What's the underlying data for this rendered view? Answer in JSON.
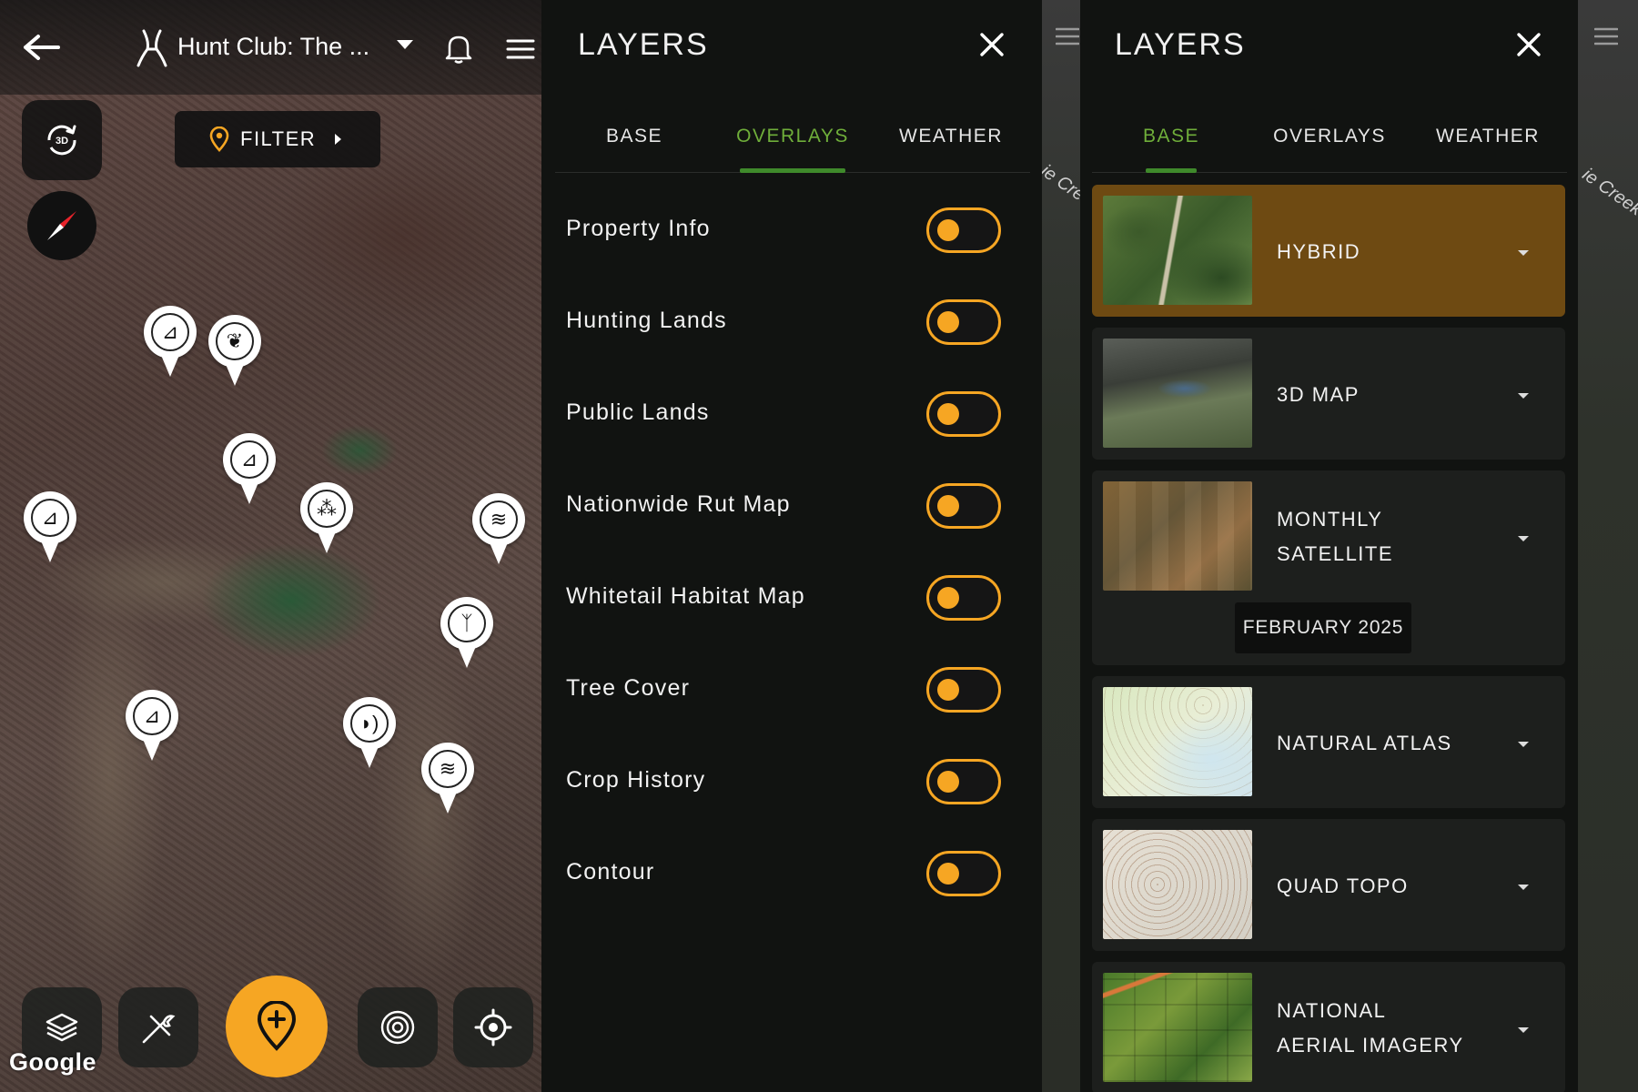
{
  "map_screen": {
    "title": "Hunt Club: The ...",
    "filter_label": "FILTER",
    "three_d_label": "3D",
    "attribution": "Google",
    "pins": [
      {
        "icon": "stand-icon"
      },
      {
        "icon": "track-icon"
      },
      {
        "icon": "stand-icon"
      },
      {
        "icon": "feeder-icon"
      },
      {
        "icon": "stand-icon"
      },
      {
        "icon": "water-icon"
      },
      {
        "icon": "bedding-icon"
      },
      {
        "icon": "stand-icon"
      },
      {
        "icon": "sound-icon"
      },
      {
        "icon": "water-icon"
      }
    ],
    "bottom_icons": [
      "layers-icon",
      "tools-icon",
      "add-marker-icon",
      "scan-icon",
      "locate-icon"
    ]
  },
  "overlays_panel": {
    "title": "LAYERS",
    "tabs": [
      {
        "label": "BASE",
        "active": false
      },
      {
        "label": "OVERLAYS",
        "active": true
      },
      {
        "label": "WEATHER",
        "active": false
      }
    ],
    "items": [
      {
        "label": "Property Info",
        "on": false
      },
      {
        "label": "Hunting Lands",
        "on": false
      },
      {
        "label": "Public Lands",
        "on": false
      },
      {
        "label": "Nationwide Rut Map",
        "on": false
      },
      {
        "label": "Whitetail Habitat Map",
        "on": false
      },
      {
        "label": "Tree Cover",
        "on": false
      },
      {
        "label": "Crop History",
        "on": false
      },
      {
        "label": "Contour",
        "on": false
      }
    ]
  },
  "base_panel": {
    "title": "LAYERS",
    "tabs": [
      {
        "label": "BASE",
        "active": true
      },
      {
        "label": "OVERLAYS",
        "active": false
      },
      {
        "label": "WEATHER",
        "active": false
      }
    ],
    "items": [
      {
        "label": "HYBRID",
        "selected": true
      },
      {
        "label": "3D MAP",
        "selected": false
      },
      {
        "label_line1": "MONTHLY",
        "label_line2": "SATELLITE",
        "date": "FEBRUARY 2025",
        "selected": false
      },
      {
        "label": "NATURAL ATLAS",
        "selected": false
      },
      {
        "label": "QUAD TOPO",
        "selected": false
      },
      {
        "label_line1": "NATIONAL",
        "label_line2": "AERIAL IMAGERY",
        "selected": false
      }
    ]
  },
  "background_map_labels": {
    "creek_left": "ie Cre",
    "creek_right": "ie Creek"
  },
  "colors": {
    "accent_orange": "#f6a623",
    "active_tab_green": "#6fae3a",
    "selected_card": "#6e4a12",
    "panel_bg": "#111311"
  }
}
